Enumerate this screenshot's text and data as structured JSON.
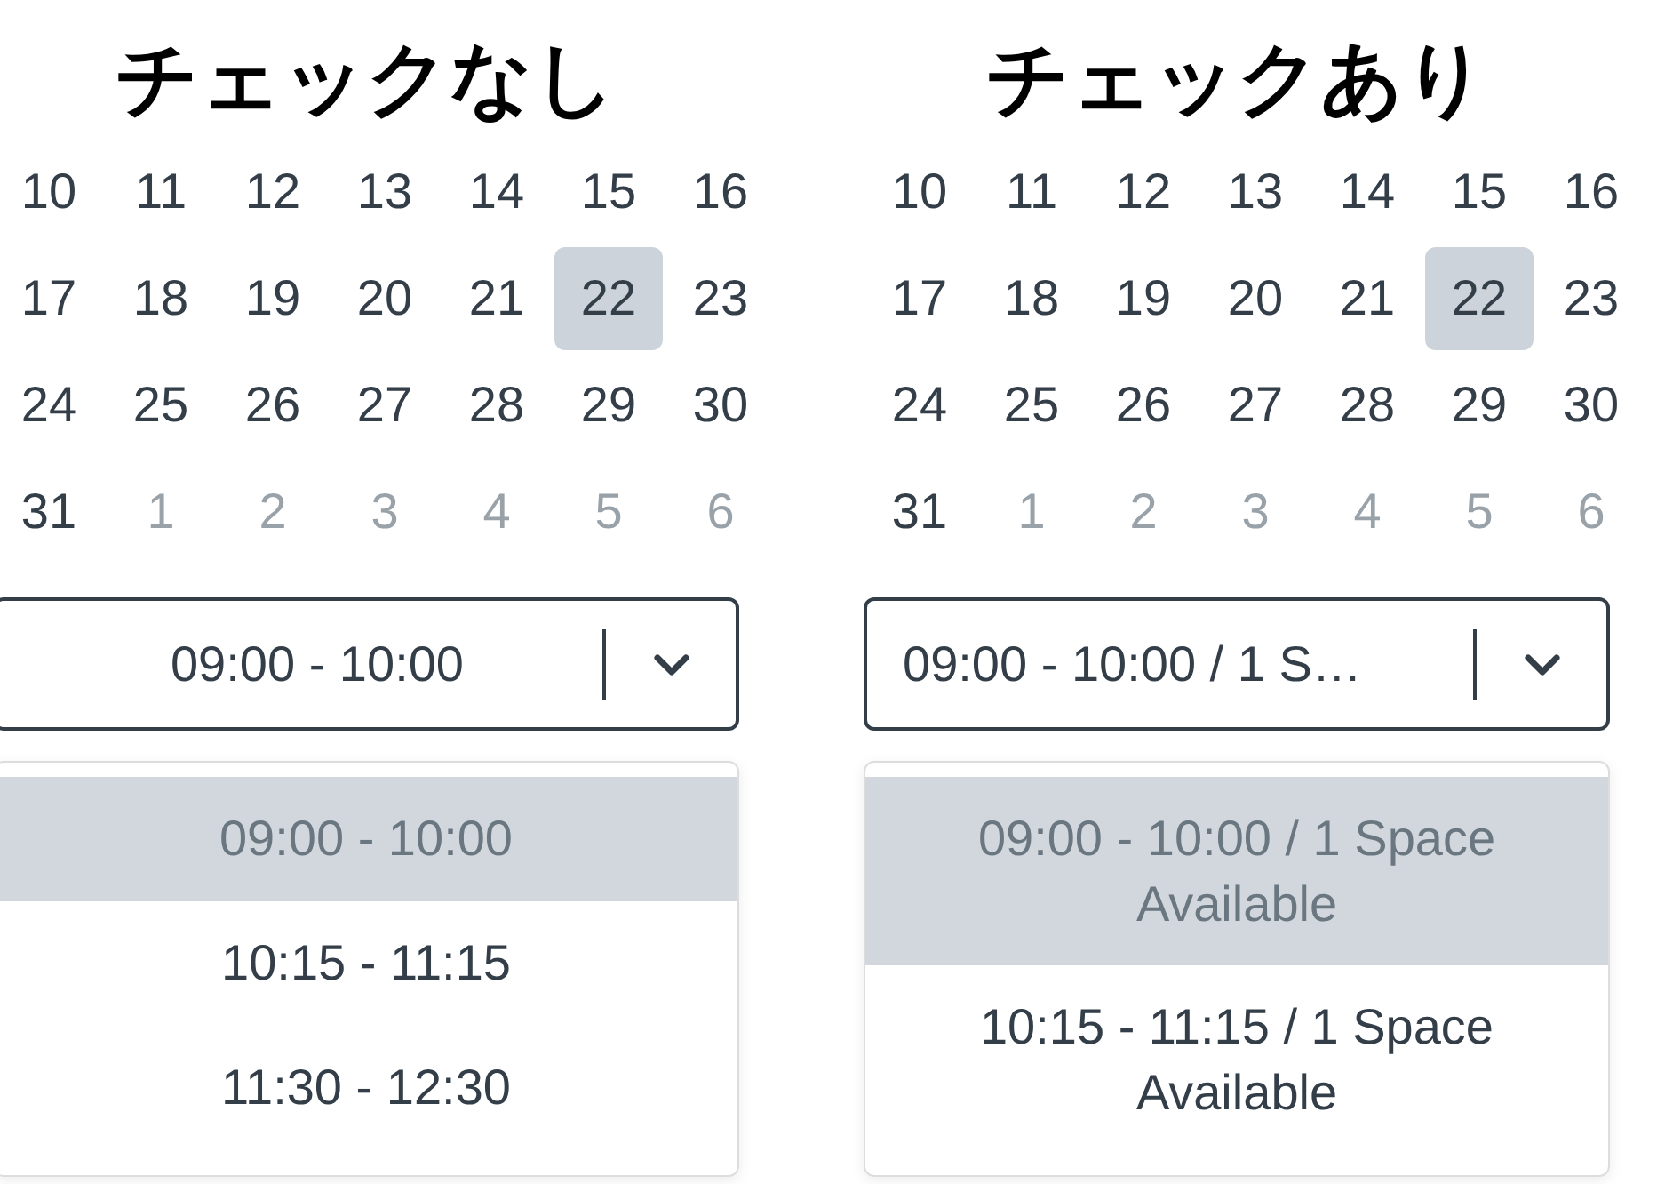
{
  "panels": [
    {
      "title": "チェックなし",
      "calendar": {
        "days": [
          {
            "label": "10",
            "outside": false,
            "selected": false
          },
          {
            "label": "11",
            "outside": false,
            "selected": false
          },
          {
            "label": "12",
            "outside": false,
            "selected": false
          },
          {
            "label": "13",
            "outside": false,
            "selected": false
          },
          {
            "label": "14",
            "outside": false,
            "selected": false
          },
          {
            "label": "15",
            "outside": false,
            "selected": false
          },
          {
            "label": "16",
            "outside": false,
            "selected": false
          },
          {
            "label": "17",
            "outside": false,
            "selected": false
          },
          {
            "label": "18",
            "outside": false,
            "selected": false
          },
          {
            "label": "19",
            "outside": false,
            "selected": false
          },
          {
            "label": "20",
            "outside": false,
            "selected": false
          },
          {
            "label": "21",
            "outside": false,
            "selected": false
          },
          {
            "label": "22",
            "outside": false,
            "selected": true
          },
          {
            "label": "23",
            "outside": false,
            "selected": false
          },
          {
            "label": "24",
            "outside": false,
            "selected": false
          },
          {
            "label": "25",
            "outside": false,
            "selected": false
          },
          {
            "label": "26",
            "outside": false,
            "selected": false
          },
          {
            "label": "27",
            "outside": false,
            "selected": false
          },
          {
            "label": "28",
            "outside": false,
            "selected": false
          },
          {
            "label": "29",
            "outside": false,
            "selected": false
          },
          {
            "label": "30",
            "outside": false,
            "selected": false
          },
          {
            "label": "31",
            "outside": false,
            "selected": false
          },
          {
            "label": "1",
            "outside": true,
            "selected": false
          },
          {
            "label": "2",
            "outside": true,
            "selected": false
          },
          {
            "label": "3",
            "outside": true,
            "selected": false
          },
          {
            "label": "4",
            "outside": true,
            "selected": false
          },
          {
            "label": "5",
            "outside": true,
            "selected": false
          },
          {
            "label": "6",
            "outside": true,
            "selected": false
          }
        ]
      },
      "time_select": {
        "value": "09:00 - 10:00",
        "kind": "centered"
      },
      "options": [
        {
          "label": "09:00 - 10:00",
          "selected": true
        },
        {
          "label": "10:15 - 11:15",
          "selected": false
        },
        {
          "label": "11:30 - 12:30",
          "selected": false
        }
      ]
    },
    {
      "title": "チェックあり",
      "calendar": {
        "days": [
          {
            "label": "10",
            "outside": false,
            "selected": false
          },
          {
            "label": "11",
            "outside": false,
            "selected": false
          },
          {
            "label": "12",
            "outside": false,
            "selected": false
          },
          {
            "label": "13",
            "outside": false,
            "selected": false
          },
          {
            "label": "14",
            "outside": false,
            "selected": false
          },
          {
            "label": "15",
            "outside": false,
            "selected": false
          },
          {
            "label": "16",
            "outside": false,
            "selected": false
          },
          {
            "label": "17",
            "outside": false,
            "selected": false
          },
          {
            "label": "18",
            "outside": false,
            "selected": false
          },
          {
            "label": "19",
            "outside": false,
            "selected": false
          },
          {
            "label": "20",
            "outside": false,
            "selected": false
          },
          {
            "label": "21",
            "outside": false,
            "selected": false
          },
          {
            "label": "22",
            "outside": false,
            "selected": true
          },
          {
            "label": "23",
            "outside": false,
            "selected": false
          },
          {
            "label": "24",
            "outside": false,
            "selected": false
          },
          {
            "label": "25",
            "outside": false,
            "selected": false
          },
          {
            "label": "26",
            "outside": false,
            "selected": false
          },
          {
            "label": "27",
            "outside": false,
            "selected": false
          },
          {
            "label": "28",
            "outside": false,
            "selected": false
          },
          {
            "label": "29",
            "outside": false,
            "selected": false
          },
          {
            "label": "30",
            "outside": false,
            "selected": false
          },
          {
            "label": "31",
            "outside": false,
            "selected": false
          },
          {
            "label": "1",
            "outside": true,
            "selected": false
          },
          {
            "label": "2",
            "outside": true,
            "selected": false
          },
          {
            "label": "3",
            "outside": true,
            "selected": false
          },
          {
            "label": "4",
            "outside": true,
            "selected": false
          },
          {
            "label": "5",
            "outside": true,
            "selected": false
          },
          {
            "label": "6",
            "outside": true,
            "selected": false
          }
        ]
      },
      "time_select": {
        "value": "09:00 - 10:00 / 1 S…",
        "kind": "left"
      },
      "options": [
        {
          "label": "09:00 - 10:00 / 1 Space Available",
          "selected": true
        },
        {
          "label": "10:15 - 11:15 / 1 Space Available",
          "selected": false
        }
      ]
    }
  ]
}
